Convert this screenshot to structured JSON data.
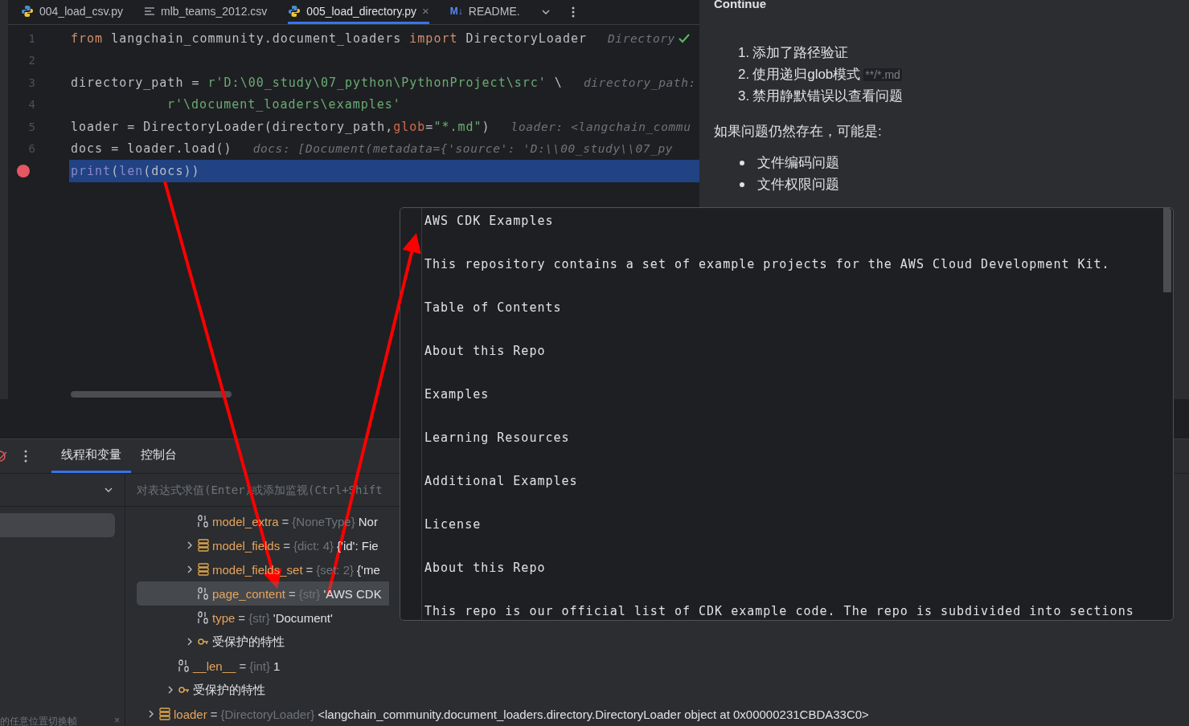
{
  "editor_tabs": [
    {
      "label": "004_load_csv.py",
      "kind": "python",
      "selected": false
    },
    {
      "label": "mlb_teams_2012.csv",
      "kind": "csv",
      "selected": false
    },
    {
      "label": "005_load_directory.py",
      "kind": "python",
      "selected": true,
      "close": "×"
    },
    {
      "label": "README.",
      "kind": "markdown",
      "selected": false,
      "icon_text": "M↓"
    }
  ],
  "code_lines": [
    {
      "number": "1",
      "breakpoint": false,
      "current": false,
      "check": true,
      "tokens": [
        {
          "text": "from ",
          "kind": "keyword"
        },
        {
          "text": "langchain_community.document_loaders ",
          "kind": "plain"
        },
        {
          "text": "import ",
          "kind": "keyword"
        },
        {
          "text": "DirectoryLoader",
          "kind": "plain"
        }
      ],
      "hint": "Directory"
    },
    {
      "number": "2",
      "breakpoint": false,
      "check": false
    },
    {
      "number": "3",
      "breakpoint": false,
      "current": false,
      "check": false,
      "tokens": [
        {
          "text": "directory_path = ",
          "kind": "plain"
        },
        {
          "text": "r'D:\\00_study\\07_python\\PythonProject\\src'",
          "kind": "string"
        },
        {
          "text": " \\",
          "kind": "plain"
        }
      ],
      "hint": "directory_path:"
    },
    {
      "number": "4",
      "breakpoint": false,
      "current": false,
      "check": false,
      "indent": true,
      "tokens": [
        {
          "text": "r'\\document_loaders\\examples'",
          "kind": "string"
        }
      ]
    },
    {
      "number": "5",
      "breakpoint": false,
      "current": false,
      "check": false,
      "tokens": [
        {
          "text": "loader = DirectoryLoader(directory_path,",
          "kind": "plain"
        },
        {
          "text": "glob",
          "kind": "param"
        },
        {
          "text": "=",
          "kind": "plain"
        },
        {
          "text": "\"*.md\"",
          "kind": "string"
        },
        {
          "text": ")",
          "kind": "plain"
        }
      ],
      "hint": "loader: <langchain_commu"
    },
    {
      "number": "6",
      "breakpoint": false,
      "current": false,
      "check": false,
      "tokens": [
        {
          "text": "docs = loader.load()",
          "kind": "plain"
        }
      ],
      "hint": "docs: [Document(metadata={'source': 'D:\\\\00_study\\\\07_py"
    },
    {
      "breakpoint": true,
      "current": true,
      "check": false,
      "tokens": [
        {
          "text": "print",
          "kind": "builtin"
        },
        {
          "text": "(",
          "kind": "plain"
        },
        {
          "text": "len",
          "kind": "builtin"
        },
        {
          "text": "(docs))",
          "kind": "plain"
        }
      ]
    }
  ],
  "chat": {
    "title": "Continue",
    "steps": [
      {
        "number": "1.",
        "text": "添加了路径验证"
      },
      {
        "number": "2.",
        "text": "使用递归glob模式",
        "code": "**/*.md"
      },
      {
        "number": "3.",
        "text": "禁用静默错误以查看问题"
      }
    ],
    "paragraph": "如果问题仍然存在，可能是:",
    "bullets": [
      "文件编码问题",
      "文件权限问题"
    ]
  },
  "debug": {
    "tabs": [
      {
        "label": "线程和变量",
        "selected": true
      },
      {
        "label": "控制台",
        "selected": false
      }
    ],
    "frames": [
      {
        "selected": true
      }
    ],
    "frames_hint": "的任意位置切换帧",
    "frames_hint_close": "×",
    "evaluate": {
      "placeholder": "对表达式求值(Enter)或添加监视(Ctrl+Shift"
    },
    "variables": [
      {
        "children": [
          {
            "children": [
              {
                "kind": "number",
                "name": "model_extra",
                "equals": "=",
                "type": "{NoneType}",
                "value": "Nor",
                "expandable": false,
                "selected": false
              },
              {
                "kind": "list",
                "name": "model_fields",
                "equals": "=",
                "type": "{dict: 4}",
                "value": "{'id': Fie",
                "expandable": true,
                "selected": false
              },
              {
                "kind": "list",
                "name": "model_fields_set",
                "equals": "=",
                "type": "{set: 2}",
                "value": "{'me",
                "expandable": true,
                "selected": false
              },
              {
                "kind": "number",
                "name": "page_content",
                "equals": "=",
                "type": "{str}",
                "value": "'AWS CDK",
                "expandable": false,
                "selected": true
              },
              {
                "kind": "number",
                "name": "type",
                "equals": "=",
                "type": "{str}",
                "value": "'Document'",
                "expandable": false,
                "selected": false
              },
              {
                "kind": "protected",
                "label": "受保护的特性",
                "expandable": true,
                "selected": false
              }
            ]
          },
          {
            "kind": "number",
            "name": "__len__",
            "equals": "=",
            "type": "{int}",
            "value": "1",
            "expandable": false,
            "selected": false
          },
          {
            "kind": "protected",
            "label": "受保护的特性",
            "expandable": true,
            "selected": false
          }
        ]
      },
      {
        "kind": "list",
        "name": "loader",
        "equals": "=",
        "type": "{DirectoryLoader}",
        "value": "<langchain_community.document_loaders.directory.DirectoryLoader object at 0x00000231CBDA33C0>",
        "expandable": true,
        "selected": false
      }
    ]
  },
  "popup": {
    "lines": [
      "AWS CDK Examples",
      "This repository contains a set of example projects for the AWS Cloud Development Kit.",
      "Table of Contents",
      "About this Repo",
      "Examples",
      "Learning Resources",
      "Additional Examples",
      "License",
      "About this Repo",
      "This repo is our official list of CDK example code. The repo is subdivided into sections"
    ]
  }
}
